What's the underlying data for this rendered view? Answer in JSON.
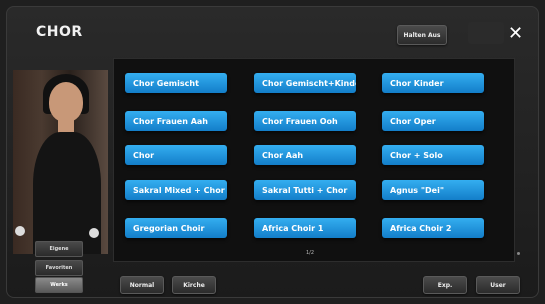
{
  "header": {
    "title": "CHOR",
    "hold_button_label": "Halten Aus",
    "close_glyph": "✕"
  },
  "voices": [
    "Chor Gemischt",
    "Chor Gemischt+Kinder",
    "Chor Kinder",
    "Chor Frauen Aah",
    "Chor Frauen Ooh",
    "Chor Oper",
    "Chor",
    "Chor Aah",
    "Chor + Solo",
    "Sakral Mixed + Chor",
    "Sakral Tutti + Chor",
    "Agnus \"Dei\"",
    "Gregorian Choir",
    "Africa Choir 1",
    "Africa Choir 2"
  ],
  "pagination": {
    "indicator": "1/2"
  },
  "side_tabs": [
    {
      "label": "Eigene",
      "active": false
    },
    {
      "label": "Favoriten",
      "active": false
    },
    {
      "label": "Werks",
      "active": true
    }
  ],
  "bottom": {
    "normal_label": "Normal",
    "kirche_label": "Kirche",
    "exp_label": "Exp.",
    "user_label": "User"
  },
  "colors": {
    "voice_button": "#1f95e0",
    "background": "#1f1f1f"
  },
  "icons": {
    "close": "close-icon"
  }
}
